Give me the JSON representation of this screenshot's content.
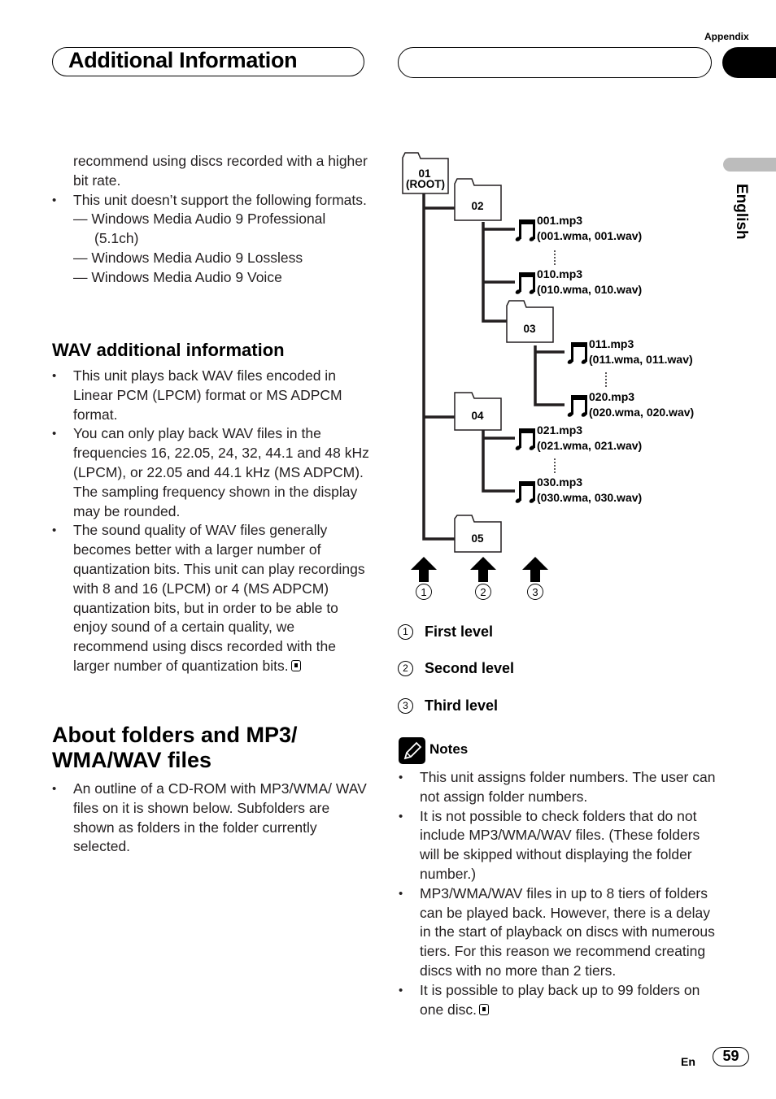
{
  "header": {
    "section_label": "Appendix",
    "title": "Additional Information",
    "language_tab": "English"
  },
  "left_column": {
    "intro_continuation": "recommend using discs recorded with a higher bit rate.",
    "unsupported_bullet": "This unit doesn’t support the following formats.",
    "unsupported_formats": [
      "— Windows Media Audio 9 Professional (5.1ch)",
      "— Windows Media Audio 9 Lossless",
      "— Windows Media Audio 9 Voice"
    ],
    "wav_heading": "WAV additional information",
    "wav_bullets": [
      "This unit plays back WAV files encoded in Linear PCM (LPCM) format or MS ADPCM format.",
      "You can only play back WAV files in the frequencies 16, 22.05, 24, 32, 44.1 and 48 kHz (LPCM), or 22.05 and 44.1 kHz (MS ADPCM). The sampling frequency shown in the display may be rounded.",
      "The sound quality of WAV files generally becomes better with a larger number of quantization bits. This unit can play recordings with 8 and 16 (LPCM) or 4 (MS ADPCM) quantization bits, but in order to be able to enjoy sound of a certain quality, we recommend using discs recorded with the larger number of quantization bits."
    ],
    "folders_heading": "About folders and MP3/ WMA/WAV files",
    "folders_bullet": "An outline of a CD-ROM with MP3/WMA/ WAV files on it is shown below. Subfolders are shown as folders in the folder currently selected."
  },
  "diagram": {
    "folders": {
      "f01_num": "01",
      "f01_root": "(ROOT)",
      "f02": "02",
      "f03": "03",
      "f04": "04",
      "f05": "05"
    },
    "files": [
      {
        "name": "001.mp3",
        "alt": "(001.wma, 001.wav)"
      },
      {
        "name": "010.mp3",
        "alt": "(010.wma, 010.wav)"
      },
      {
        "name": "011.mp3",
        "alt": "(011.wma, 011.wav)"
      },
      {
        "name": "020.mp3",
        "alt": "(020.wma, 020.wav)"
      },
      {
        "name": "021.mp3",
        "alt": "(021.wma, 021.wav)"
      },
      {
        "name": "030.mp3",
        "alt": "(030.wma, 030.wav)"
      }
    ],
    "level_markers": [
      "1",
      "2",
      "3"
    ],
    "legend": [
      {
        "num": "1",
        "label": "First level"
      },
      {
        "num": "2",
        "label": "Second level"
      },
      {
        "num": "3",
        "label": "Third level"
      }
    ]
  },
  "notes": {
    "title": "Notes",
    "items": [
      "This unit assigns folder numbers. The user can not assign folder numbers.",
      "It is not possible to check folders that do not include MP3/WMA/WAV files. (These folders will be skipped without displaying the folder number.)",
      "MP3/WMA/WAV files in up to 8 tiers of folders can be played back. However, there is a delay in the start of playback on discs with numerous tiers. For this reason we recommend creating discs with no more than 2 tiers.",
      "It is possible to play back up to 99 folders on one disc."
    ]
  },
  "footer": {
    "lang_code": "En",
    "page_number": "59"
  }
}
